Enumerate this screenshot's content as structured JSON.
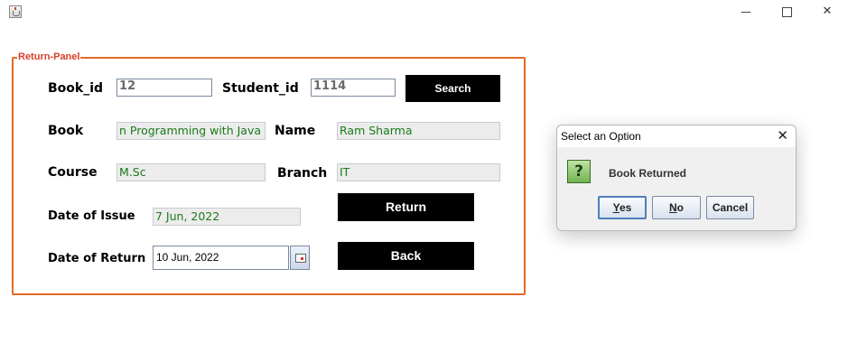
{
  "window": {
    "close_glyph": "✕"
  },
  "panel": {
    "title": "Return-Panel",
    "labels": {
      "book_id": "Book_id",
      "student_id": "Student_id",
      "book": "Book",
      "name": "Name",
      "course": "Course",
      "branch": "Branch",
      "date_of_issue": "Date of Issue",
      "date_of_return": "Date of Return"
    },
    "values": {
      "book_id": "12",
      "student_id": "1114",
      "book": "n Programming with Java",
      "name": "Ram Sharma",
      "course": "M.Sc",
      "branch": "IT",
      "date_of_issue": "7 Jun, 2022",
      "date_of_return": "10 Jun, 2022"
    },
    "buttons": {
      "search": "Search",
      "return": "Return",
      "back": "Back"
    }
  },
  "dialog": {
    "title": "Select an Option",
    "close_glyph": "✕",
    "icon": "?",
    "message": "Book Returned",
    "buttons": {
      "yes_mnemonic": "Y",
      "yes_rest": "es",
      "no_mnemonic": "N",
      "no_rest": "o",
      "cancel": "Cancel"
    }
  },
  "colors": {
    "panel_border": "#e06a2a",
    "panel_title": "#d8402a",
    "readonly_text": "#1a7a1a"
  }
}
